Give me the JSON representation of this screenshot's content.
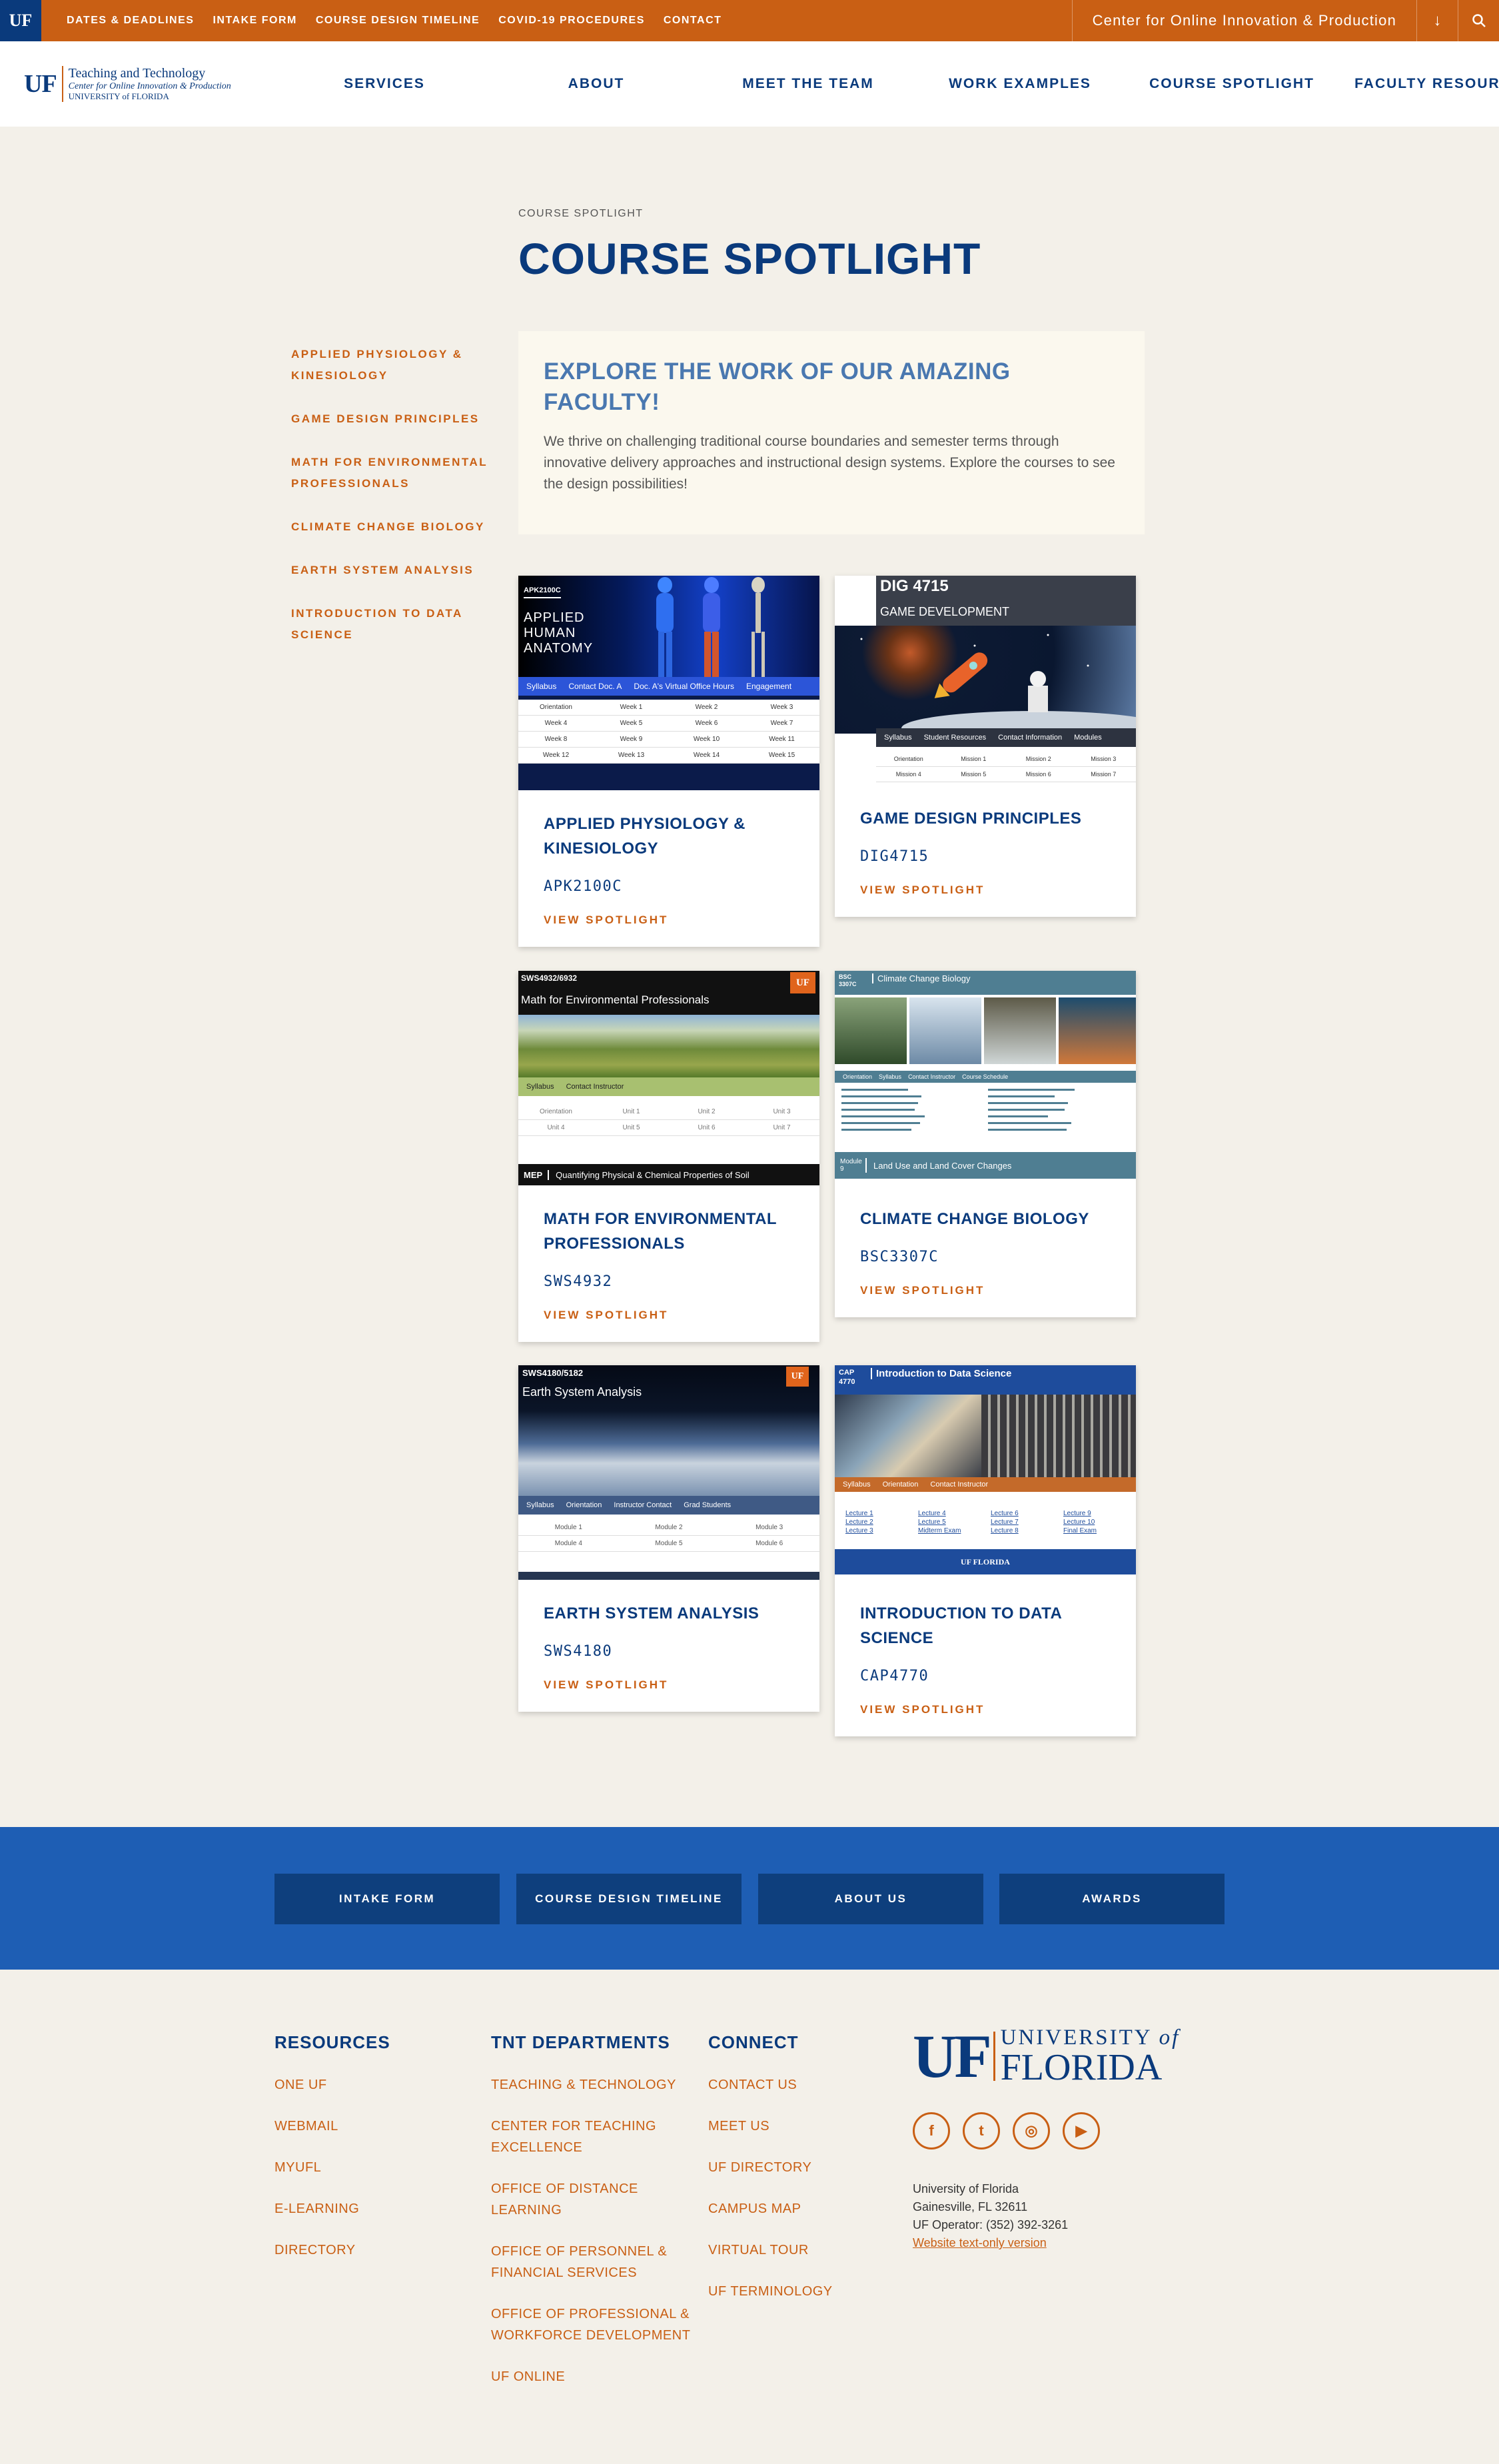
{
  "topbar": {
    "uf_badge": "UF",
    "links": [
      "DATES & DEADLINES",
      "INTAKE FORM",
      "COURSE DESIGN TIMELINE",
      "COVID-19 PROCEDURES",
      "CONTACT"
    ],
    "center_select": "Center for Online Innovation & Production",
    "arrow_icon": "↓",
    "search_icon": "⌕"
  },
  "logo": {
    "uf": "UF",
    "line1": "Teaching and Technology",
    "line2": "Center for Online Innovation & Production",
    "line3": "UNIVERSITY of FLORIDA"
  },
  "nav": [
    "SERVICES",
    "ABOUT",
    "MEET THE TEAM",
    "WORK EXAMPLES",
    "COURSE SPOTLIGHT",
    "FACULTY RESOURCES"
  ],
  "breadcrumb": "COURSE SPOTLIGHT",
  "page_title": "COURSE SPOTLIGHT",
  "sidenav": [
    "APPLIED PHYSIOLOGY & KINESIOLOGY",
    "GAME DESIGN PRINCIPLES",
    "MATH FOR ENVIRONMENTAL PROFESSIONALS",
    "CLIMATE CHANGE BIOLOGY",
    "EARTH SYSTEM ANALYSIS",
    "INTRODUCTION TO DATA SCIENCE"
  ],
  "intro": {
    "heading": "EXPLORE THE WORK OF OUR AMAZING FACULTY!",
    "text": "We thrive on challenging traditional course boundaries and semester terms through innovative delivery approaches and instructional design systems. Explore the courses to see the design possibilities!"
  },
  "view_label": "VIEW SPOTLIGHT",
  "cards": [
    {
      "title": "APPLIED PHYSIOLOGY & KINESIOLOGY",
      "code": "APK2100C",
      "thumb": {
        "code": "APK2100C",
        "title": "APPLIED HUMAN ANATOMY",
        "bar": [
          "Syllabus",
          "Contact Doc. A",
          "Doc. A's Virtual Office Hours",
          "Engagement"
        ],
        "cells": [
          "Orientation",
          "Week 1",
          "Week 2",
          "Week 3",
          "Week 4",
          "Week 5",
          "Week 6",
          "Week 7",
          "Week 8",
          "Week 9",
          "Week 10",
          "Week 11",
          "Week 12",
          "Week 13",
          "Week 14",
          "Week 15"
        ]
      }
    },
    {
      "title": "GAME DESIGN PRINCIPLES",
      "code": "DIG4715",
      "thumb": {
        "code": "DIG 4715",
        "title": "GAME DEVELOPMENT",
        "bar": [
          "Syllabus",
          "Student Resources",
          "Contact Information",
          "Modules"
        ],
        "cells": [
          "Orientation",
          "Mission 1",
          "Mission 2",
          "Mission 3",
          "Mission 4",
          "Mission 5",
          "Mission 6",
          "Mission 7"
        ]
      }
    },
    {
      "title": "MATH FOR ENVIRONMENTAL PROFESSIONALS",
      "code": "SWS4932",
      "thumb": {
        "code": "SWS4932/6932",
        "title": "Math for Environmental Professionals",
        "bar": [
          "Syllabus",
          "Contact Instructor"
        ],
        "cells": [
          "Orientation",
          "Unit 1",
          "Unit 2",
          "Unit 3",
          "Unit 4",
          "Unit 5",
          "Unit 6",
          "Unit 7"
        ],
        "footer": "Quantifying Physical & Chemical Properties of Soil",
        "footer_tag": "MEP",
        "uf": "UF"
      }
    },
    {
      "title": "CLIMATE CHANGE BIOLOGY",
      "code": "BSC3307C",
      "thumb": {
        "code": "BSC 3307C",
        "title": "Climate Change Biology",
        "bar": [
          "Orientation",
          "Syllabus",
          "Contact Instructor",
          "Course Schedule"
        ],
        "footer": "Land Use and Land Cover Changes",
        "footer_tag": "Module 9"
      }
    },
    {
      "title": "EARTH SYSTEM ANALYSIS",
      "code": "SWS4180",
      "thumb": {
        "code": "SWS4180/5182",
        "title": "Earth System Analysis",
        "bar": [
          "Syllabus",
          "Orientation",
          "Instructor Contact",
          "Grad Students"
        ],
        "cells": [
          "Module 1",
          "Module 2",
          "Module 3",
          "Module 4",
          "Module 5",
          "Module 6"
        ],
        "uf": "UF"
      }
    },
    {
      "title": "INTRODUCTION TO DATA SCIENCE",
      "code": "CAP4770",
      "thumb": {
        "code": "CAP 4770",
        "title": "Introduction to Data Science",
        "bar": [
          "Syllabus",
          "Orientation",
          "Contact Instructor"
        ],
        "cells": [
          "Lecture 1",
          "Lecture 4",
          "Lecture 6",
          "Lecture 9",
          "Lecture 2",
          "Lecture 5",
          "Lecture 7",
          "Lecture 10",
          "Lecture 3",
          "Midterm Exam",
          "Lecture 8",
          "Final Exam"
        ],
        "footer": "UF FLORIDA"
      }
    }
  ],
  "band_buttons": [
    "INTAKE FORM",
    "COURSE DESIGN TIMELINE",
    "ABOUT US",
    "AWARDS"
  ],
  "footer": {
    "resources": {
      "heading": "RESOURCES",
      "links": [
        "ONE UF",
        "WEBMAIL",
        "MYUFL",
        "E-LEARNING",
        "DIRECTORY"
      ]
    },
    "tnt": {
      "heading": "TNT DEPARTMENTS",
      "links": [
        "TEACHING & TECHNOLOGY",
        "CENTER FOR TEACHING EXCELLENCE",
        "OFFICE OF DISTANCE LEARNING",
        "OFFICE OF PERSONNEL & FINANCIAL SERVICES",
        "OFFICE OF PROFESSIONAL & WORKFORCE DEVELOPMENT",
        "UF ONLINE"
      ]
    },
    "connect": {
      "heading": "CONNECT",
      "links": [
        "CONTACT US",
        "MEET US",
        "UF DIRECTORY",
        "CAMPUS MAP",
        "VIRTUAL TOUR",
        "UF TERMINOLOGY"
      ]
    },
    "uf_logo": {
      "uf": "UF",
      "university": "UNIVERSITY",
      "of": "of",
      "florida": "FLORIDA"
    },
    "social": [
      "f",
      "t",
      "◎",
      "▶"
    ],
    "address": [
      "University of Florida",
      "Gainesville, FL 32611",
      "UF Operator: (352) 392-3261"
    ],
    "text_only": "Website text-only version"
  }
}
